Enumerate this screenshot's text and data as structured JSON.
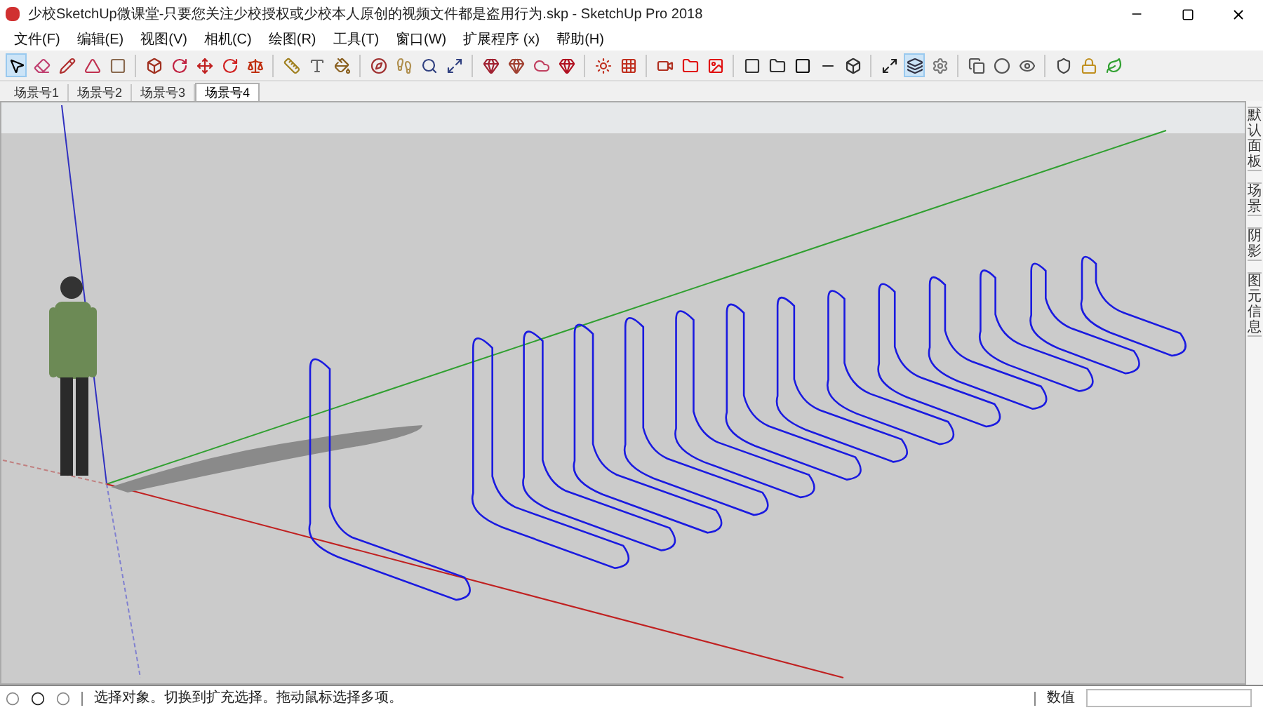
{
  "window": {
    "title": "少校SketchUp微课堂-只要您关注少校授权或少校本人原创的视频文件都是盗用行为.skp - SketchUp Pro 2018"
  },
  "menu": [
    "文件(F)",
    "编辑(E)",
    "视图(V)",
    "相机(C)",
    "绘图(R)",
    "工具(T)",
    "窗口(W)",
    "扩展程序 (x)",
    "帮助(H)"
  ],
  "scene_tabs": [
    {
      "label": "场景号1",
      "selected": false
    },
    {
      "label": "场景号2",
      "selected": false
    },
    {
      "label": "场景号3",
      "selected": false
    },
    {
      "label": "场景号4",
      "selected": true
    }
  ],
  "tray_tabs": [
    "默认面板",
    "场景",
    "阴影",
    "图元信息"
  ],
  "status_bar": {
    "message": "选择对象。切换到扩充选择。拖动鼠标选择多项。",
    "measurements_label": "数值"
  }
}
